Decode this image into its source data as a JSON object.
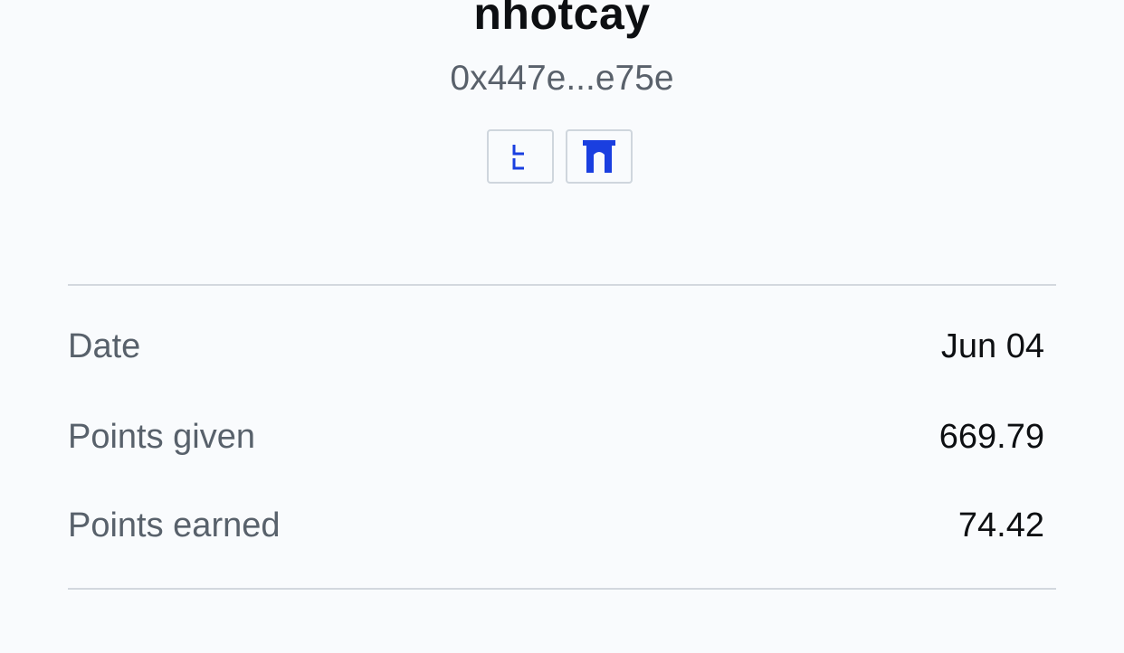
{
  "profile": {
    "username": "nhotcay",
    "address": "0x447e...e75e"
  },
  "links": [
    {
      "icon": "lens-icon",
      "color": "#1a3fe0"
    },
    {
      "icon": "gateway-icon",
      "color": "#1a3fe0"
    }
  ],
  "stats": {
    "date": {
      "label": "Date",
      "value": "Jun 04"
    },
    "points_given": {
      "label": "Points given",
      "value": "669.79"
    },
    "points_earned": {
      "label": "Points earned",
      "value": "74.42"
    }
  }
}
